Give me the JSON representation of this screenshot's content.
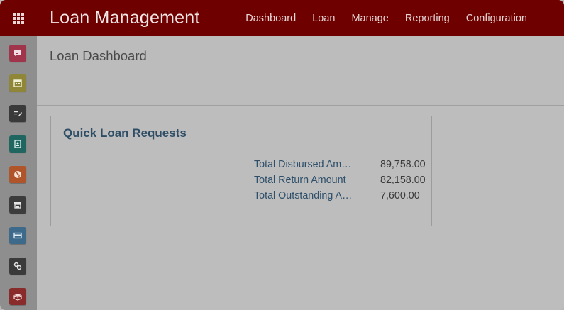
{
  "header": {
    "app_title": "Loan Management",
    "apps_icon": "grid-icon",
    "nav": [
      "Dashboard",
      "Loan",
      "Manage",
      "Reporting",
      "Configuration"
    ]
  },
  "sidebar": {
    "icons": [
      {
        "name": "discuss-icon",
        "color": "#a0344a"
      },
      {
        "name": "calendar-icon",
        "color": "#8f8637"
      },
      {
        "name": "notes-icon",
        "color": "#3a3a3a"
      },
      {
        "name": "contacts-icon",
        "color": "#1f6660"
      },
      {
        "name": "website-icon",
        "color": "#b0552a"
      },
      {
        "name": "store-icon",
        "color": "#3c3c3c"
      },
      {
        "name": "payment-card-icon",
        "color": "#3d6a8a"
      },
      {
        "name": "link-icon",
        "color": "#3a3a3a"
      },
      {
        "name": "inventory-icon",
        "color": "#8a2b2b"
      }
    ]
  },
  "main": {
    "breadcrumb": "Loan Dashboard",
    "card": {
      "title": "Quick Loan Requests",
      "rows": [
        {
          "label": "Total Disbursed Am…",
          "value": "89,758.00"
        },
        {
          "label": "Total Return Amount",
          "value": "82,158.00"
        },
        {
          "label": "Total Outstanding A…",
          "value": "7,600.00"
        }
      ]
    }
  },
  "colors": {
    "topbar": "#6f0000",
    "link_text": "#2d4f6a"
  }
}
